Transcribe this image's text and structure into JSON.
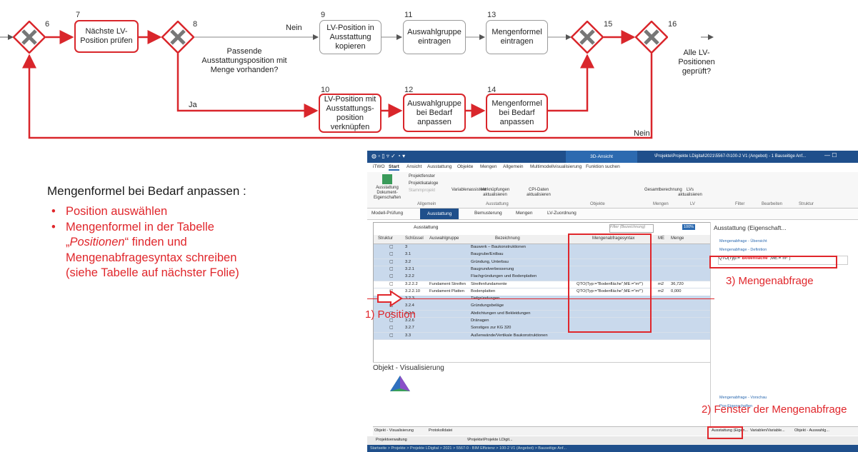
{
  "process": {
    "gateway_numbers": [
      "6",
      "8",
      "15",
      "16"
    ],
    "nodes": [
      {
        "num": "7",
        "label": "Nächste LV-Position prüfen"
      },
      {
        "num": "9",
        "label": "LV-Position in Ausstattung kopieren"
      },
      {
        "num": "11",
        "label": "Auswahlgruppe eintragen"
      },
      {
        "num": "13",
        "label": "Mengenformel eintragen"
      },
      {
        "num": "10",
        "label": "LV-Position mit Ausstattungs-position verknüpfen"
      },
      {
        "num": "12",
        "label": "Auswahlgruppe bei Bedarf anpassen"
      },
      {
        "num": "14",
        "label": "Mengenformel bei Bedarf anpassen"
      }
    ],
    "labels": {
      "nein_top": "Nein",
      "question8": "Passende Ausstattungsposition mit Menge vorhanden?",
      "ja": "Ja",
      "question16": "Alle LV-Positionen geprüft?",
      "nein_bottom": "Nein"
    }
  },
  "slide": {
    "heading": "Mengenformel bei Bedarf anpassen :",
    "bullet1": "Position auswählen",
    "bullet2_line1": "Mengenformel in der Tabelle",
    "bullet2_line2_pre": "„",
    "bullet2_line2_em": "Positionen",
    "bullet2_line2_post": "“ finden und",
    "bullet2_line3": "Mengenabfragesyntax schreiben",
    "bullet2_line4": "(siehe Tabelle auf nächster Folie)"
  },
  "screenshot": {
    "context_tab": "3D-Ansicht",
    "title_path": "\\Projekte\\Projekte LDigital\\2021\\5567-0\\100-2 V1 (Angebot) - 1 Bauseitige Anf...",
    "ribbon_tabs": [
      "iTWO",
      "Start",
      "Ansicht",
      "Ausstattung",
      "Objekte",
      "Mengen",
      "Allgemein",
      "Multimodellvisualisierung",
      "Funktion suchen"
    ],
    "ribbon_buttons": [
      "Ausstattung Dokument-Eigenschaften",
      "Projektfenster",
      "Projektkataloge",
      "Stammprojekt",
      "Variablenassistent",
      "Verknüpfungen aktualisieren",
      "CPI-Daten aktualisieren",
      "Gesamtberechnung",
      "LVs aktualisieren"
    ],
    "ribbon_groups": [
      "Allgemein",
      "Ausstattung",
      "Objekte",
      "Mengen",
      "LV",
      "Filter",
      "Bearbeiten",
      "Struktur"
    ],
    "breadcrumb": [
      "Modell-Prüfung",
      "Ausstattung",
      "Bemusterung",
      "Mengen",
      "LV-Zuordnung"
    ],
    "grid_title": "Ausstattung",
    "filter_placeholder": "Filter (Bezeichnung)",
    "zoom": "100%",
    "columns": [
      "Struktur",
      "Schlüssel",
      "Auswahlgruppe",
      "Bezeichnung",
      "Mengenabfragesyntax",
      "ME",
      "Menge"
    ],
    "rows": [
      {
        "key": "3",
        "group": "",
        "name": "Bauwerk – Baukonstruktionen",
        "syntax": "",
        "me": "",
        "qty": ""
      },
      {
        "key": "3.1",
        "group": "",
        "name": "Baugrube/Erdbau",
        "syntax": "",
        "me": "",
        "qty": ""
      },
      {
        "key": "3.2",
        "group": "",
        "name": "Gründung, Unterbau",
        "syntax": "",
        "me": "",
        "qty": ""
      },
      {
        "key": "3.2.1",
        "group": "",
        "name": "Baugrundverbesserung",
        "syntax": "",
        "me": "",
        "qty": ""
      },
      {
        "key": "3.2.2",
        "group": "",
        "name": "Flachgründungen und Bodenplatten",
        "syntax": "",
        "me": "",
        "qty": ""
      },
      {
        "key": "3.2.2.2",
        "group": "Fundament Streifen",
        "name": "Streifenfundamente",
        "syntax": "QTO(Typ:=\"Bodenfläche\";ME:=\"m²\")",
        "me": "m2",
        "qty": "36,720"
      },
      {
        "key": "3.2.2.10",
        "group": "Fundament Platten",
        "name": "Bodenplatten",
        "syntax": "QTO(Typ:=\"Bodenfläche\";ME:=\"m²\")",
        "me": "m2",
        "qty": "0,000"
      },
      {
        "key": "3.2.3",
        "group": "",
        "name": "Tiefgründungen",
        "syntax": "",
        "me": "",
        "qty": ""
      },
      {
        "key": "3.2.4",
        "group": "",
        "name": "Gründungsbeläge",
        "syntax": "",
        "me": "",
        "qty": ""
      },
      {
        "key": "3.2.5",
        "group": "",
        "name": "Abdichtungen und Bekleidungen",
        "syntax": "",
        "me": "",
        "qty": ""
      },
      {
        "key": "3.2.6",
        "group": "",
        "name": "Dränagen",
        "syntax": "",
        "me": "",
        "qty": ""
      },
      {
        "key": "3.2.7",
        "group": "",
        "name": "Sonstiges zur KG 320",
        "syntax": "",
        "me": "",
        "qty": ""
      },
      {
        "key": "3.3",
        "group": "",
        "name": "Außenwände/Vertikale Baukonstruktionen",
        "syntax": "",
        "me": "",
        "qty": ""
      }
    ],
    "props_title": "Ausstattung (Eigenschaft...",
    "props_sections": [
      "Mengenabfrage - Übersicht",
      "Mengenabfrage - Definition",
      "Mengenabfrage - Vorschau",
      "Pos-Eigenschaften"
    ],
    "qto_prefix": "QTO(Typ:=",
    "qto_value": "\"Bodenfläche\"",
    "qto_suffix": ";ME:=\"m²\")",
    "viz_title": "Objekt - Visualisierung",
    "bottom_tabs_left": [
      "Objekt - Visualisierung",
      "Protokolldatei"
    ],
    "bottom_tabs_right": [
      "Ausstattung (Eigen...",
      "Variablen/Variable...",
      "Objekt - Auswahlg..."
    ],
    "taskbar": [
      "Projektverwaltung",
      "\\Projekte\\Projekte LDigit..."
    ],
    "status_text": "Startseite  >  Projekte  >  Projekte LDigital  >  2021  >  5567-0 - BIM Effizienz  >  100-2 V1 (Angebot)  >  Bauseitige Anf..."
  },
  "annotations": {
    "a1": "1) Position",
    "a2": "2) Fenster der Mengenabfrage",
    "a3": "3) Mengenabfrage"
  },
  "colors": {
    "accent_red": "#d9262b",
    "grey_border": "#9a9a9a",
    "ribbon_blue": "#1f4f8b",
    "row_blue": "#c9d9ec"
  }
}
